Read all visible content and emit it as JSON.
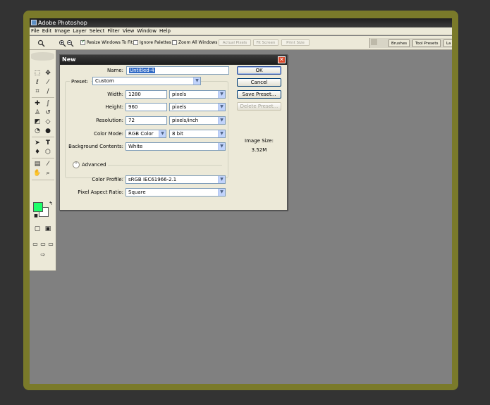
{
  "window": {
    "title": "Adobe Photoshop"
  },
  "menu": [
    "File",
    "Edit",
    "Image",
    "Layer",
    "Select",
    "Filter",
    "View",
    "Window",
    "Help"
  ],
  "options_bar": {
    "resize_windows": {
      "label": "Resize Windows To Fit",
      "checked": true
    },
    "ignore_palettes": {
      "label": "Ignore Palettes",
      "checked": false
    },
    "zoom_all_windows": {
      "label": "Zoom All Windows",
      "checked": false
    },
    "actual_pixels": "Actual Pixels",
    "fit_screen": "Fit Screen",
    "print_size": "Print Size"
  },
  "palette_well": {
    "tabs": [
      "Brushes",
      "Tool Presets",
      "La"
    ]
  },
  "toolbox": {
    "foreground_color": "#1eff6a",
    "background_color": "#ffffff"
  },
  "dialog": {
    "title": "New",
    "close_glyph": "✕",
    "name": {
      "label": "Name:",
      "value": "Untitled-4"
    },
    "preset": {
      "label": "Preset:",
      "value": "Custom"
    },
    "width": {
      "label": "Width:",
      "value": "1280",
      "unit": "pixels"
    },
    "height": {
      "label": "Height:",
      "value": "960",
      "unit": "pixels"
    },
    "resolution": {
      "label": "Resolution:",
      "value": "72",
      "unit": "pixels/inch"
    },
    "color_mode": {
      "label": "Color Mode:",
      "value": "RGB Color",
      "depth": "8 bit"
    },
    "background_contents": {
      "label": "Background Contents:",
      "value": "White"
    },
    "advanced": {
      "label": "Advanced",
      "toggle_glyph": "⌃"
    },
    "color_profile": {
      "label": "Color Profile:",
      "value": "sRGB IEC61966-2.1"
    },
    "pixel_aspect_ratio": {
      "label": "Pixel Aspect Ratio:",
      "value": "Square"
    },
    "buttons": {
      "ok": "OK",
      "cancel": "Cancel",
      "save_preset": "Save Preset...",
      "delete_preset": "Delete Preset..."
    },
    "image_size": {
      "label": "Image Size:",
      "value": "3.52M"
    }
  },
  "icons": {
    "dropdown_arrow": "▼"
  }
}
